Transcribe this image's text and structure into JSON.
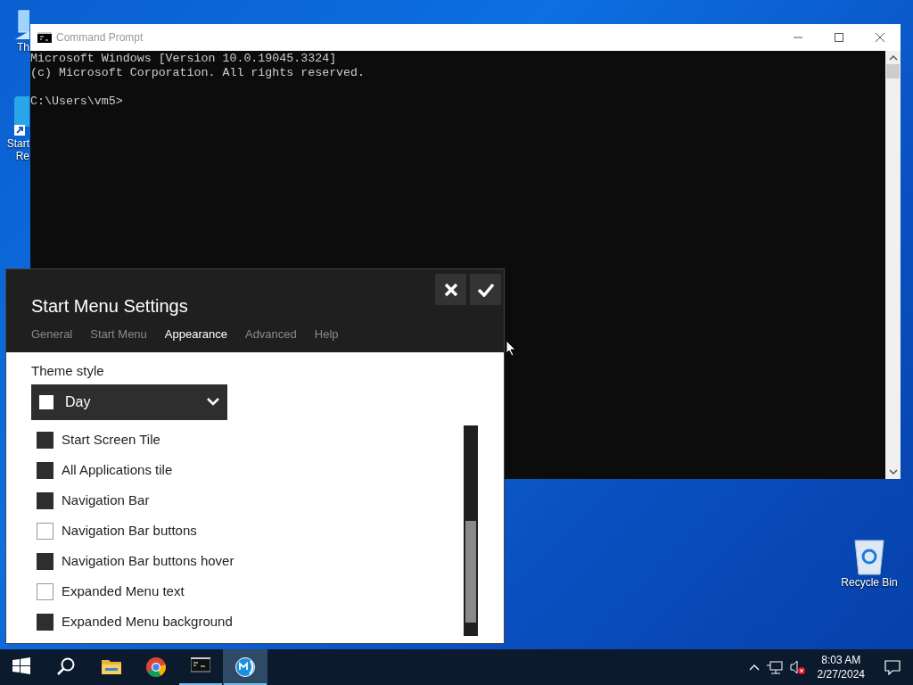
{
  "desktop_icons": [
    {
      "kind": "pc",
      "lines": [
        "Th"
      ]
    },
    {
      "kind": "shortcut",
      "lines": [
        "Start",
        "Re"
      ]
    },
    {
      "kind": "recycle",
      "lines": [
        "Recycle Bin"
      ]
    }
  ],
  "console_window": {
    "title": "Command Prompt",
    "output": [
      "Microsoft Windows [Version 10.0.19045.3324]",
      "(c) Microsoft Corporation. All rights reserved."
    ],
    "prompt": "C:\\Users\\vm5>"
  },
  "settings": {
    "title": "Start Menu Settings",
    "tabs": [
      {
        "label": "General",
        "selected": false
      },
      {
        "label": "Start Menu",
        "selected": false
      },
      {
        "label": "Appearance",
        "selected": true
      },
      {
        "label": "Advanced",
        "selected": false
      },
      {
        "label": "Help",
        "selected": false
      }
    ],
    "theme_label": "Theme style",
    "theme_value": "Day",
    "options": [
      {
        "label": "Start Screen Tile",
        "checked": true
      },
      {
        "label": "All Applications tile",
        "checked": true
      },
      {
        "label": "Navigation Bar",
        "checked": true
      },
      {
        "label": "Navigation Bar buttons",
        "checked": false
      },
      {
        "label": "Navigation Bar buttons hover",
        "checked": true
      },
      {
        "label": "Expanded Menu text",
        "checked": false
      },
      {
        "label": "Expanded Menu background",
        "checked": true
      }
    ]
  },
  "taskbar": {
    "apps": [
      {
        "kind": "start",
        "open": false
      },
      {
        "kind": "search",
        "open": false
      },
      {
        "kind": "folder",
        "open": false
      },
      {
        "kind": "chrome",
        "open": false
      },
      {
        "kind": "console",
        "open": true,
        "selected": false
      },
      {
        "kind": "startmenu",
        "open": true,
        "selected": true
      }
    ],
    "time": "8:03 AM",
    "date": "2/27/2024"
  }
}
